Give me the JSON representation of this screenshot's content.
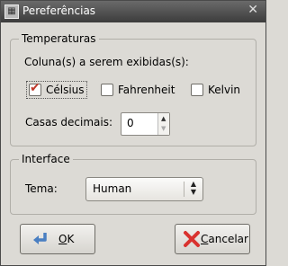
{
  "window": {
    "title": "Pereferências"
  },
  "temperatures": {
    "legend": "Temperaturas",
    "columns_label": "Coluna(s) a serem exibidas(s):",
    "checkboxes": [
      {
        "label": "Célsius",
        "checked": true
      },
      {
        "label": "Fahrenheit",
        "checked": false
      },
      {
        "label": "Kelvin",
        "checked": false
      }
    ],
    "decimals_label": "Casas decimais:",
    "decimals_value": "0"
  },
  "interface": {
    "legend": "Interface",
    "theme_label": "Tema:",
    "theme_value": "Human"
  },
  "buttons": {
    "ok_label": "OK",
    "ok_mnemonic": "O",
    "ok_rest": "K",
    "cancel_mnemonic": "C",
    "cancel_rest": "ancelar"
  },
  "colors": {
    "titlebar": "#3c3c3c",
    "check_accent": "#c0392b",
    "cancel_icon": "#d9322f",
    "ok_icon": "#4a7fc2"
  }
}
